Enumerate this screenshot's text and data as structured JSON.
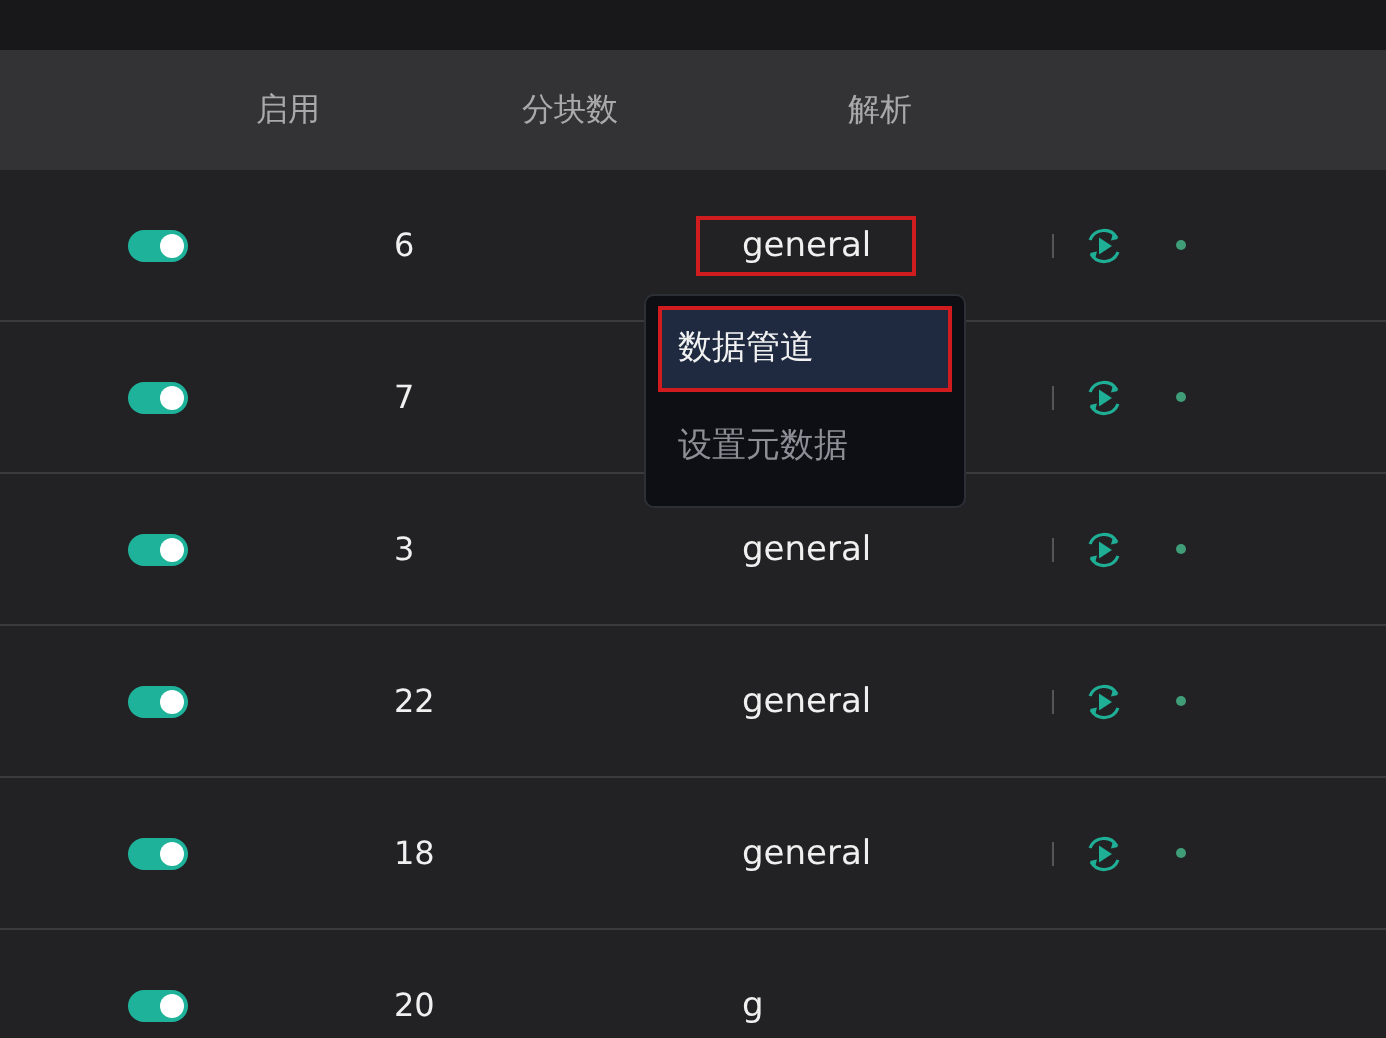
{
  "table": {
    "columns": [
      "启用",
      "分块数",
      "解析"
    ],
    "rows": [
      {
        "enabled": true,
        "chunks": "6",
        "parser": "general",
        "highlighted": true,
        "actions": true
      },
      {
        "enabled": true,
        "chunks": "7",
        "actions": true
      },
      {
        "enabled": true,
        "chunks": "3",
        "parser": "general",
        "actions": true
      },
      {
        "enabled": true,
        "chunks": "22",
        "parser": "general",
        "actions": true
      },
      {
        "enabled": true,
        "chunks": "18",
        "parser": "general",
        "actions": true
      },
      {
        "enabled": true,
        "chunks": "20",
        "parser": "g",
        "actions": false
      }
    ]
  },
  "menu": {
    "items": [
      {
        "label": "数据管道",
        "selected": true,
        "highlighted": true
      },
      {
        "label": "设置元数据",
        "selected": false
      }
    ]
  }
}
